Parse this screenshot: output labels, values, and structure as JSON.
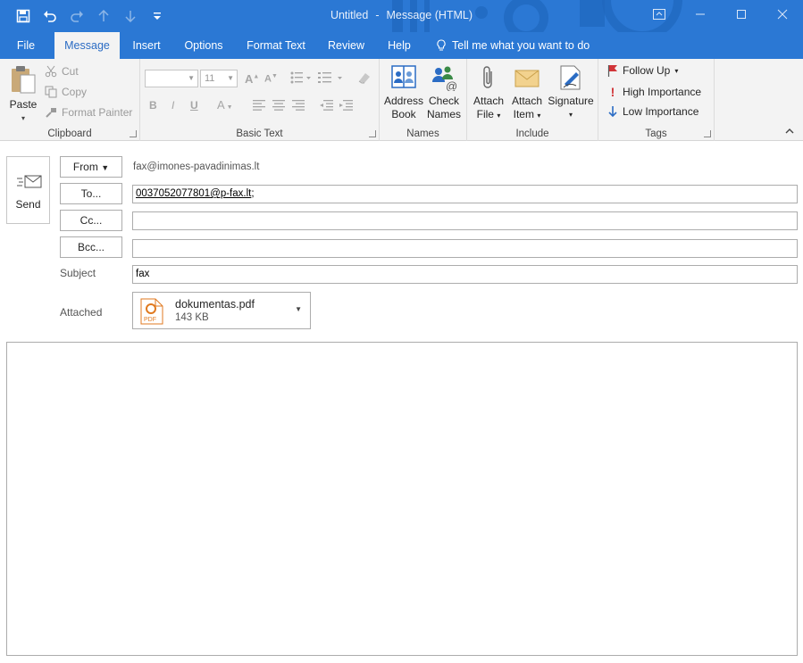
{
  "window": {
    "title_doc": "Untitled",
    "title_sep": "-",
    "title_type": "Message (HTML)",
    "accent": "#2b78d4"
  },
  "qat": [
    "save-icon",
    "undo-icon",
    "redo-icon",
    "up-arrow-icon",
    "down-arrow-icon",
    "customize-icon"
  ],
  "tabs": [
    "File",
    "Message",
    "Insert",
    "Options",
    "Format Text",
    "Review",
    "Help"
  ],
  "tell_me": "Tell me what you want to do",
  "ribbon": {
    "clipboard": {
      "paste": "Paste",
      "cut": "Cut",
      "copy": "Copy",
      "format_painter": "Format Painter",
      "label": "Clipboard"
    },
    "basic_text": {
      "font_size": "11",
      "label": "Basic Text"
    },
    "names": {
      "address_book_1": "Address",
      "address_book_2": "Book",
      "check_names_1": "Check",
      "check_names_2": "Names",
      "label": "Names"
    },
    "include": {
      "attach_file_1": "Attach",
      "attach_file_2": "File",
      "attach_item_1": "Attach",
      "attach_item_2": "Item",
      "signature": "Signature",
      "label": "Include"
    },
    "tags": {
      "follow_up": "Follow Up",
      "high_importance": "High Importance",
      "low_importance": "Low Importance",
      "label": "Tags"
    }
  },
  "compose": {
    "send": "Send",
    "from_btn": "From",
    "from_address": "fax@imones-pavadinimas.lt",
    "to_btn": "To...",
    "to_value": "0037052077801@p-fax.lt",
    "to_suffix": ";",
    "cc_btn": "Cc...",
    "cc_value": "",
    "bcc_btn": "Bcc...",
    "bcc_value": "",
    "subject_label": "Subject",
    "subject_value": "fax",
    "attached_label": "Attached",
    "attachment": {
      "name": "dokumentas.pdf",
      "size": "143 KB",
      "icon_text": "PDF"
    }
  }
}
